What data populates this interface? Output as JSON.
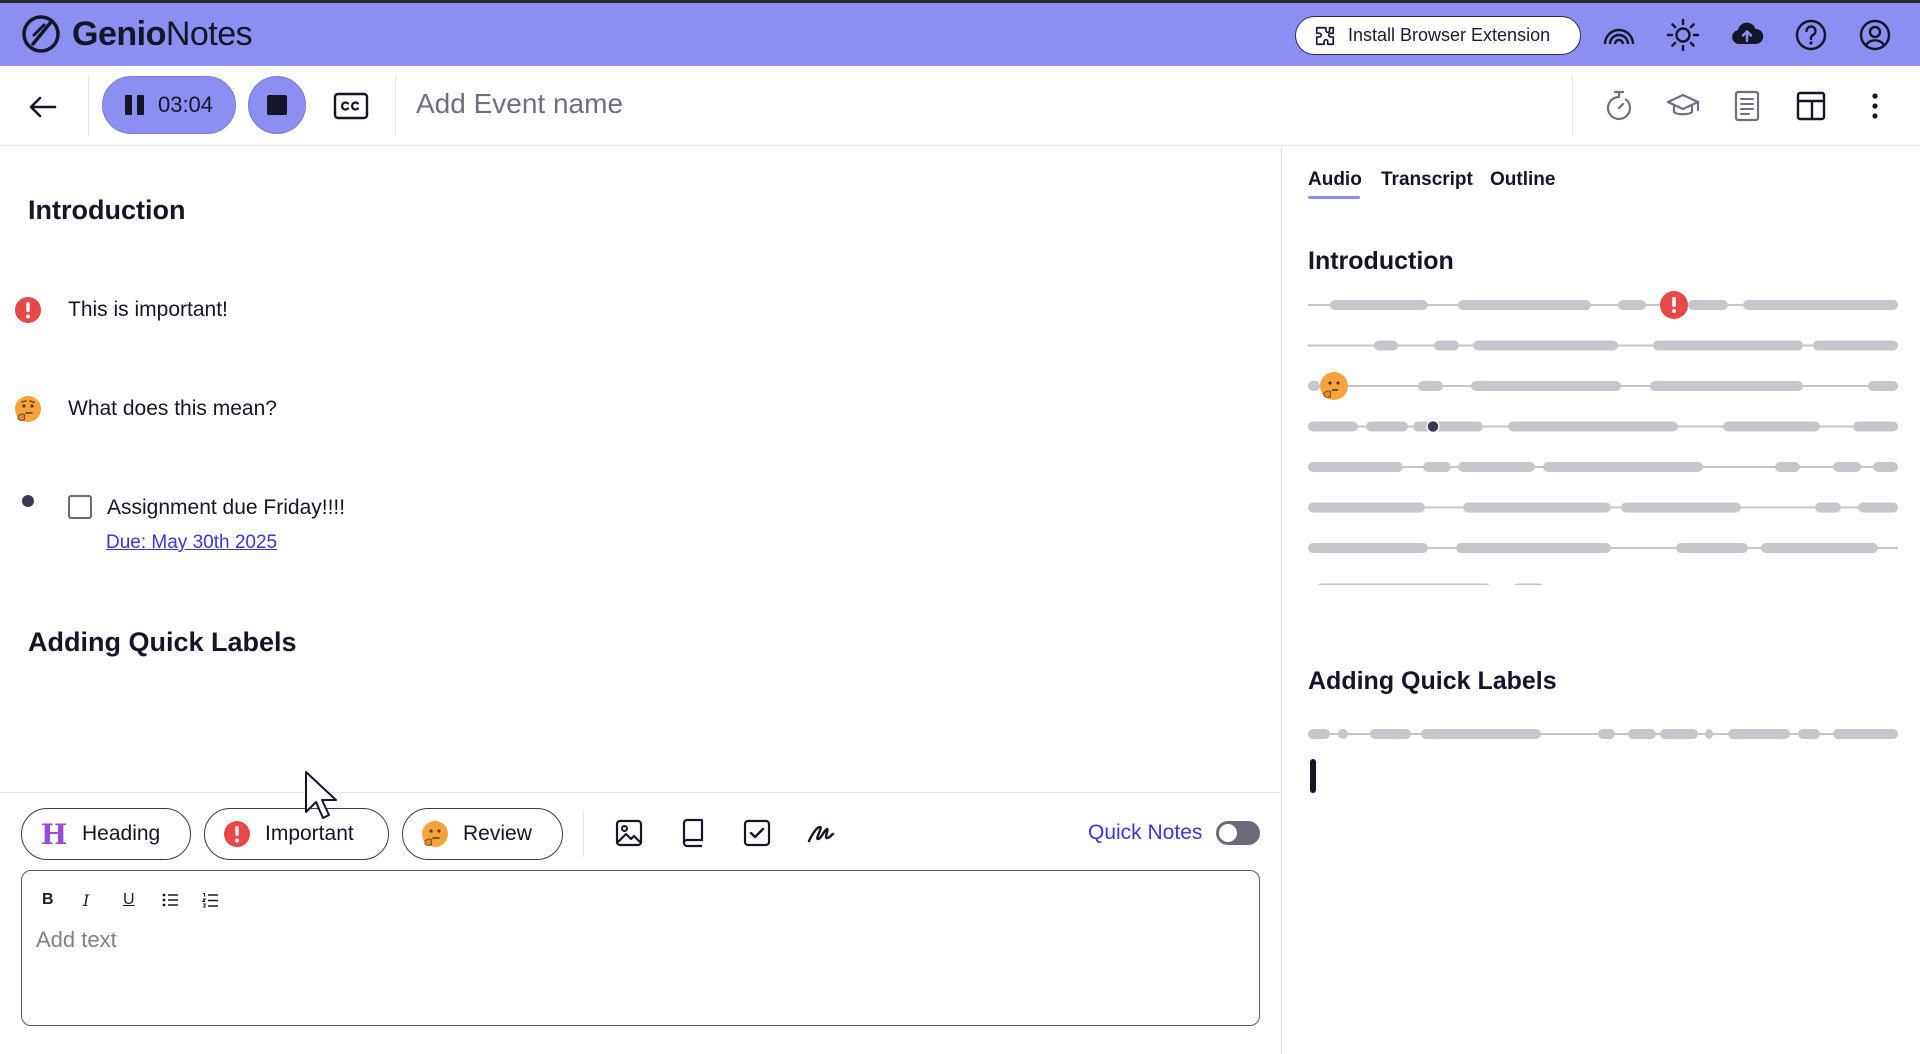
{
  "app": {
    "brand_bold": "Genio",
    "brand_light": "Notes",
    "extension_button": "Install Browser Extension",
    "top_icons": [
      "rainbow-icon",
      "sun-icon",
      "cloud-upload-icon",
      "help-icon",
      "account-icon"
    ],
    "accent_color": "#8c8ef2"
  },
  "toolbar": {
    "timer": "03:04",
    "event_name_placeholder": "Add Event name",
    "right_icons": [
      "timer-icon",
      "graduation-cap-icon",
      "document-icon",
      "layout-icon",
      "more-vertical-icon"
    ]
  },
  "notes": {
    "heading_1": "Introduction",
    "items": [
      {
        "label": "important",
        "text": "This is important!"
      },
      {
        "label": "review",
        "text": "What does this mean?"
      },
      {
        "label": "task",
        "text": "Assignment due Friday!!!!",
        "due": "Due: May 30th 2025"
      }
    ],
    "heading_2": "Adding Quick Labels"
  },
  "labels_bar": {
    "chips": [
      "Heading",
      "Important",
      "Review"
    ],
    "tools": [
      "image-icon",
      "book-icon",
      "checkbox-icon",
      "draw-icon"
    ],
    "quick_notes_label": "Quick Notes",
    "quick_notes_enabled": false
  },
  "editor": {
    "format_buttons": [
      "B",
      "I",
      "U",
      "bullet-list",
      "numbered-list"
    ],
    "placeholder": "Add text"
  },
  "right_panel": {
    "tabs": [
      "Audio",
      "Transcript",
      "Outline"
    ],
    "active_tab": "Audio",
    "section_1": "Introduction",
    "section_2": "Adding Quick Labels"
  }
}
